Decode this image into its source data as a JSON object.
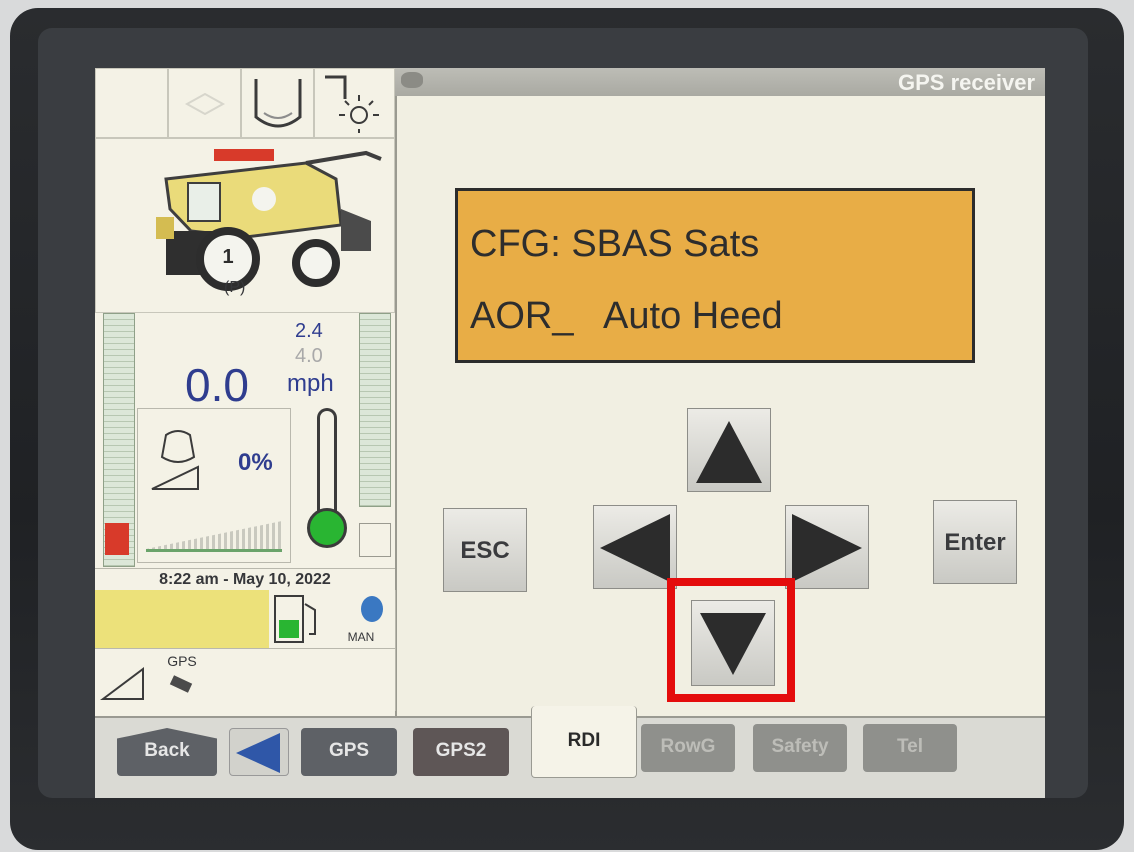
{
  "header": {
    "title": "GPS receiver"
  },
  "display": {
    "line1": "CFG: SBAS Sats",
    "line2": "AOR_   Auto Heed"
  },
  "keypad": {
    "esc_label": "ESC",
    "enter_label": "Enter"
  },
  "status": {
    "speed_value": "0.0",
    "speed_upper": "2.4",
    "speed_lower": "4.0",
    "speed_unit": "mph",
    "engine_load": "0%",
    "datetime": "8:22 am - May 10, 2022",
    "gps_label": "GPS",
    "man_label": "MAN",
    "park_symbol": "(P)",
    "machine_number": "1"
  },
  "tabs": {
    "back_label": "Back",
    "items": [
      "GPS",
      "GPS2",
      "RDI",
      "RowG",
      "Safety",
      "Tel"
    ]
  },
  "colors": {
    "accent_display": "#e8ad46",
    "highlight": "#e40c0c",
    "header_text": "#f5f5f0"
  }
}
